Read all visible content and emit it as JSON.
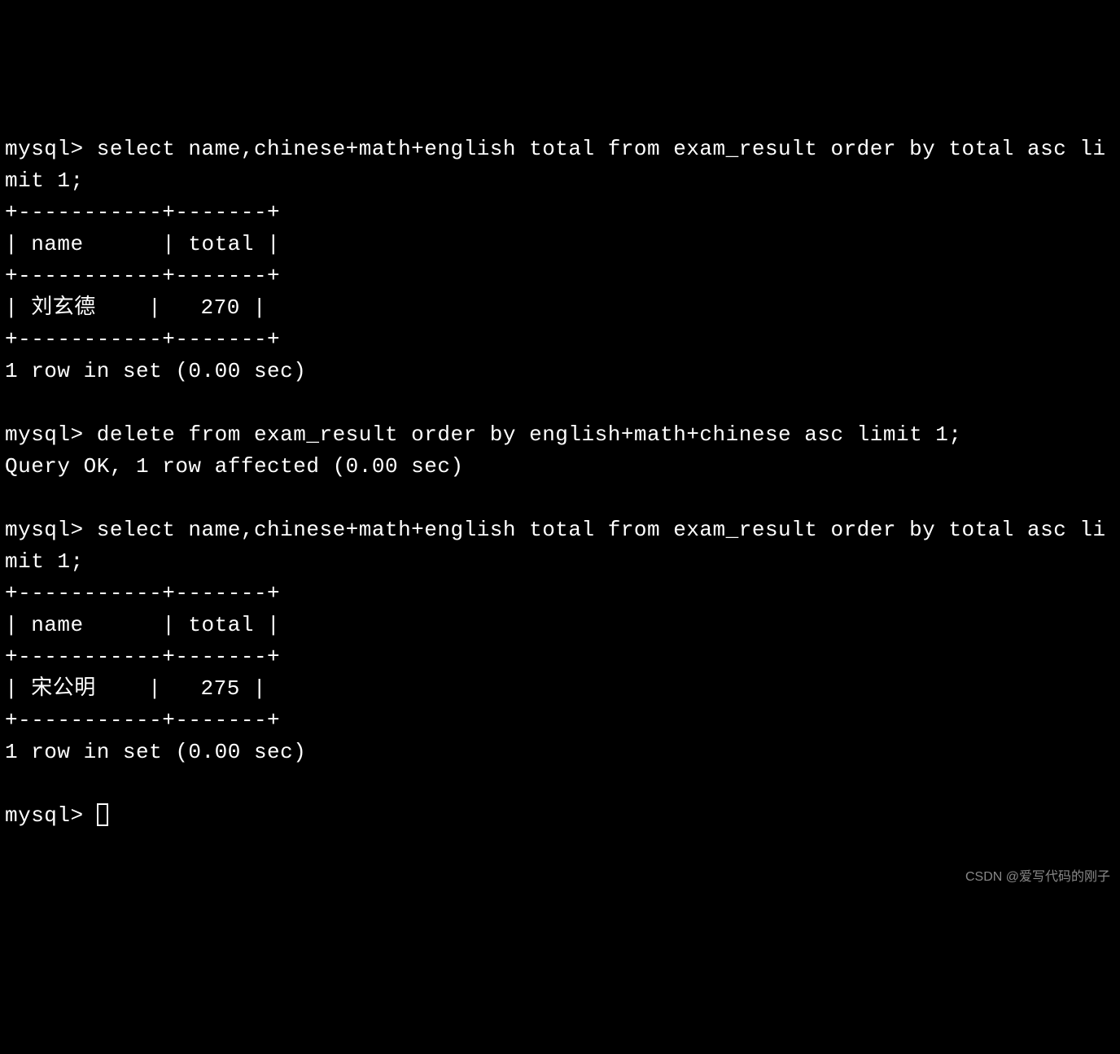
{
  "terminal": {
    "block1": {
      "prompt": "mysql> ",
      "command": "select name,chinese+math+english total from exam_result order by total asc limit 1;",
      "table_sep": "+-----------+-------+",
      "header": "| name      | total |",
      "row": "| 刘玄德    |   270 |",
      "footer": "1 row in set (0.00 sec)"
    },
    "block2": {
      "prompt": "mysql> ",
      "command": "delete from exam_result order by english+math+chinese asc limit 1;",
      "result": "Query OK, 1 row affected (0.00 sec)"
    },
    "block3": {
      "prompt": "mysql> ",
      "command": "select name,chinese+math+english total from exam_result order by total asc limit 1;",
      "table_sep": "+-----------+-------+",
      "header": "| name      | total |",
      "row": "| 宋公明    |   275 |",
      "footer": "1 row in set (0.00 sec)"
    },
    "final_prompt": "mysql> ",
    "watermark": "CSDN @爱写代码的刚子"
  }
}
